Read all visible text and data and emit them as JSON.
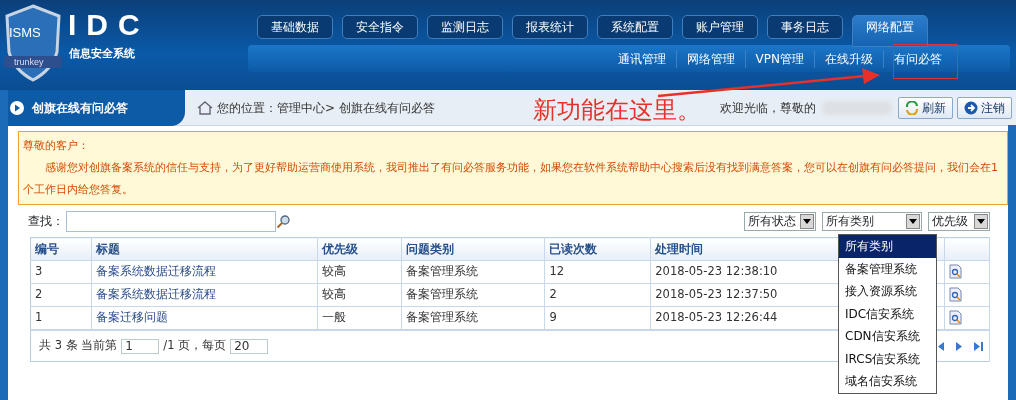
{
  "header": {
    "logo_badge": "ISMS",
    "logo_ribbon": "trunkey",
    "title": "IDC",
    "subtitle": "信息安全系统",
    "tabs": [
      {
        "label": "基础数据",
        "selected": false
      },
      {
        "label": "安全指令",
        "selected": false
      },
      {
        "label": "监测日志",
        "selected": false
      },
      {
        "label": "报表统计",
        "selected": false
      },
      {
        "label": "系统配置",
        "selected": false
      },
      {
        "label": "账户管理",
        "selected": false
      },
      {
        "label": "事务日志",
        "selected": false
      },
      {
        "label": "网络配置",
        "selected": true
      }
    ],
    "subtabs": [
      "通讯管理",
      "网络管理",
      "VPN管理",
      "在线升级",
      "有问必答"
    ]
  },
  "page_title": "创旗在线有问必答",
  "breadcrumb": "您的位置：管理中心> 创旗在线有问必答",
  "welcome": "欢迎光临，尊敬的",
  "buttons": [
    {
      "label": "刷新",
      "kind": "refresh"
    },
    {
      "label": "注销",
      "kind": "logout"
    }
  ],
  "annotation": {
    "text": "新功能在这里。"
  },
  "notice": {
    "title": "尊敬的客户：",
    "body": "感谢您对创旗备案系统的信任与支持，为了更好帮助运营商使用系统，我司推出了有问必答服务功能，如果您在软件系统帮助中心搜索后没有找到满意答案，您可以在创旗有问必答提问，我们会在1个工作日内给您答复。"
  },
  "search": {
    "label": "查找："
  },
  "filters": [
    "所有状态",
    "所有类别",
    "优先级"
  ],
  "dropdown": {
    "options": [
      {
        "label": "所有类别",
        "selected": true
      },
      {
        "label": "备案管理系统",
        "selected": false
      },
      {
        "label": "接入资源系统",
        "selected": false
      },
      {
        "label": "IDC信安系统",
        "selected": false
      },
      {
        "label": "CDN信安系统",
        "selected": false
      },
      {
        "label": "IRCS信安系统",
        "selected": false
      },
      {
        "label": "域名信安系统",
        "selected": false
      }
    ]
  },
  "table": {
    "columns": [
      "编号",
      "标题",
      "优先级",
      "问题类别",
      "已读次数",
      "处理时间"
    ],
    "rows": [
      [
        "3",
        "备案系统数据迁移流程",
        "较高",
        "备案管理系统",
        "12",
        "2018-05-23 12:38:10"
      ],
      [
        "2",
        "备案系统数据迁移流程",
        "较高",
        "备案管理系统",
        "2",
        "2018-05-23 12:37:50"
      ],
      [
        "1",
        "备案迁移问题",
        "一般",
        "备案管理系统",
        "9",
        "2018-05-23 12:26:44"
      ]
    ]
  },
  "pager": {
    "before": "共 3 条 当前第",
    "page": "1",
    "middle": "/1 页，每页",
    "per_page": "20"
  }
}
